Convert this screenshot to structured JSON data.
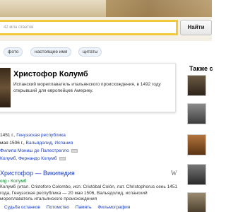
{
  "search": {
    "placeholder": "42 млн ответов",
    "button_label": "Найти"
  },
  "filters": [
    "фото",
    "настоящее имя",
    "цитаты"
  ],
  "entity_card": {
    "title": "Христофор Колумб",
    "description": "Испанский мореплаватель итальянского происхождения, в 1492 году открывший для европейцев Америку."
  },
  "related": {
    "title": "Также с"
  },
  "facts": [
    {
      "prefix": "1451 г., ",
      "link": "Генуэзская республика",
      "icon": false
    },
    {
      "prefix": "мая 1506 г., ",
      "link": "Вальядолид, Испания",
      "icon": false
    },
    {
      "prefix": "",
      "link": "Филипа Мониш де Палестрелло",
      "icon": true
    },
    {
      "prefix": "",
      "link": "Колумб, Фернандо Колумб",
      "icon": true
    }
  ],
  "wiki": {
    "title": "Христофор — Википедия",
    "mark": "W",
    "url": "org › Колумб",
    "snippet": "Колумб (итал. Cristoforo Colombo, исп. Cristóbal Colón, лат. Christophorus сень 1451 года, Генуэзская республика — 20 мая 1506, Вальядолид, испанский мореплаватель итальянского происхождения",
    "links": [
      "Судьба останков",
      "Потомство",
      "Память",
      "Фильмография"
    ]
  }
}
